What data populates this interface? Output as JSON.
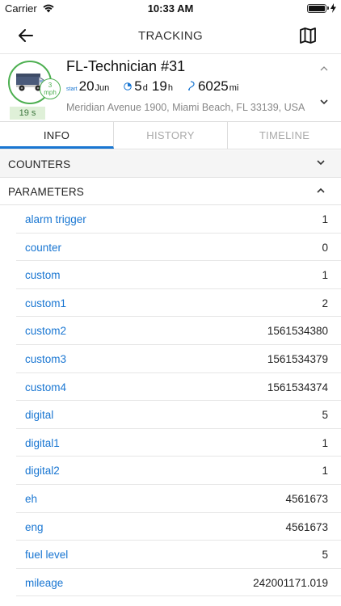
{
  "status": {
    "carrier": "Carrier",
    "time": "10:33 AM"
  },
  "nav": {
    "title": "TRACKING"
  },
  "vehicle": {
    "name": "FL-Technician #31",
    "speed_value": "3",
    "speed_unit": "mph",
    "age": "19 s",
    "start_label": "start",
    "start_day": "20",
    "start_month": "Jun",
    "duration_days": "5",
    "duration_days_unit": "d",
    "duration_hours": "19",
    "duration_hours_unit": "h",
    "distance": "6025",
    "distance_unit": "mi",
    "address": "Meridian Avenue 1900, Miami Beach, FL 33139, USA"
  },
  "tabs": [
    {
      "label": "INFO"
    },
    {
      "label": "HISTORY"
    },
    {
      "label": "TIMELINE"
    }
  ],
  "sections": {
    "counters": "COUNTERS",
    "parameters": "PARAMETERS"
  },
  "parameters": [
    {
      "name": "alarm trigger",
      "value": "1"
    },
    {
      "name": "counter",
      "value": "0"
    },
    {
      "name": "custom",
      "value": "1"
    },
    {
      "name": "custom1",
      "value": "2"
    },
    {
      "name": "custom2",
      "value": "1561534380"
    },
    {
      "name": "custom3",
      "value": "1561534379"
    },
    {
      "name": "custom4",
      "value": "1561534374"
    },
    {
      "name": "digital",
      "value": "5"
    },
    {
      "name": "digital1",
      "value": "1"
    },
    {
      "name": "digital2",
      "value": "1"
    },
    {
      "name": "eh",
      "value": "4561673"
    },
    {
      "name": "eng",
      "value": "4561673"
    },
    {
      "name": "fuel level",
      "value": "5"
    },
    {
      "name": "mileage",
      "value": "242001171.019"
    }
  ],
  "colors": {
    "accent": "#1976d2",
    "online": "#4caf50",
    "age_bg": "#dff0d8"
  }
}
